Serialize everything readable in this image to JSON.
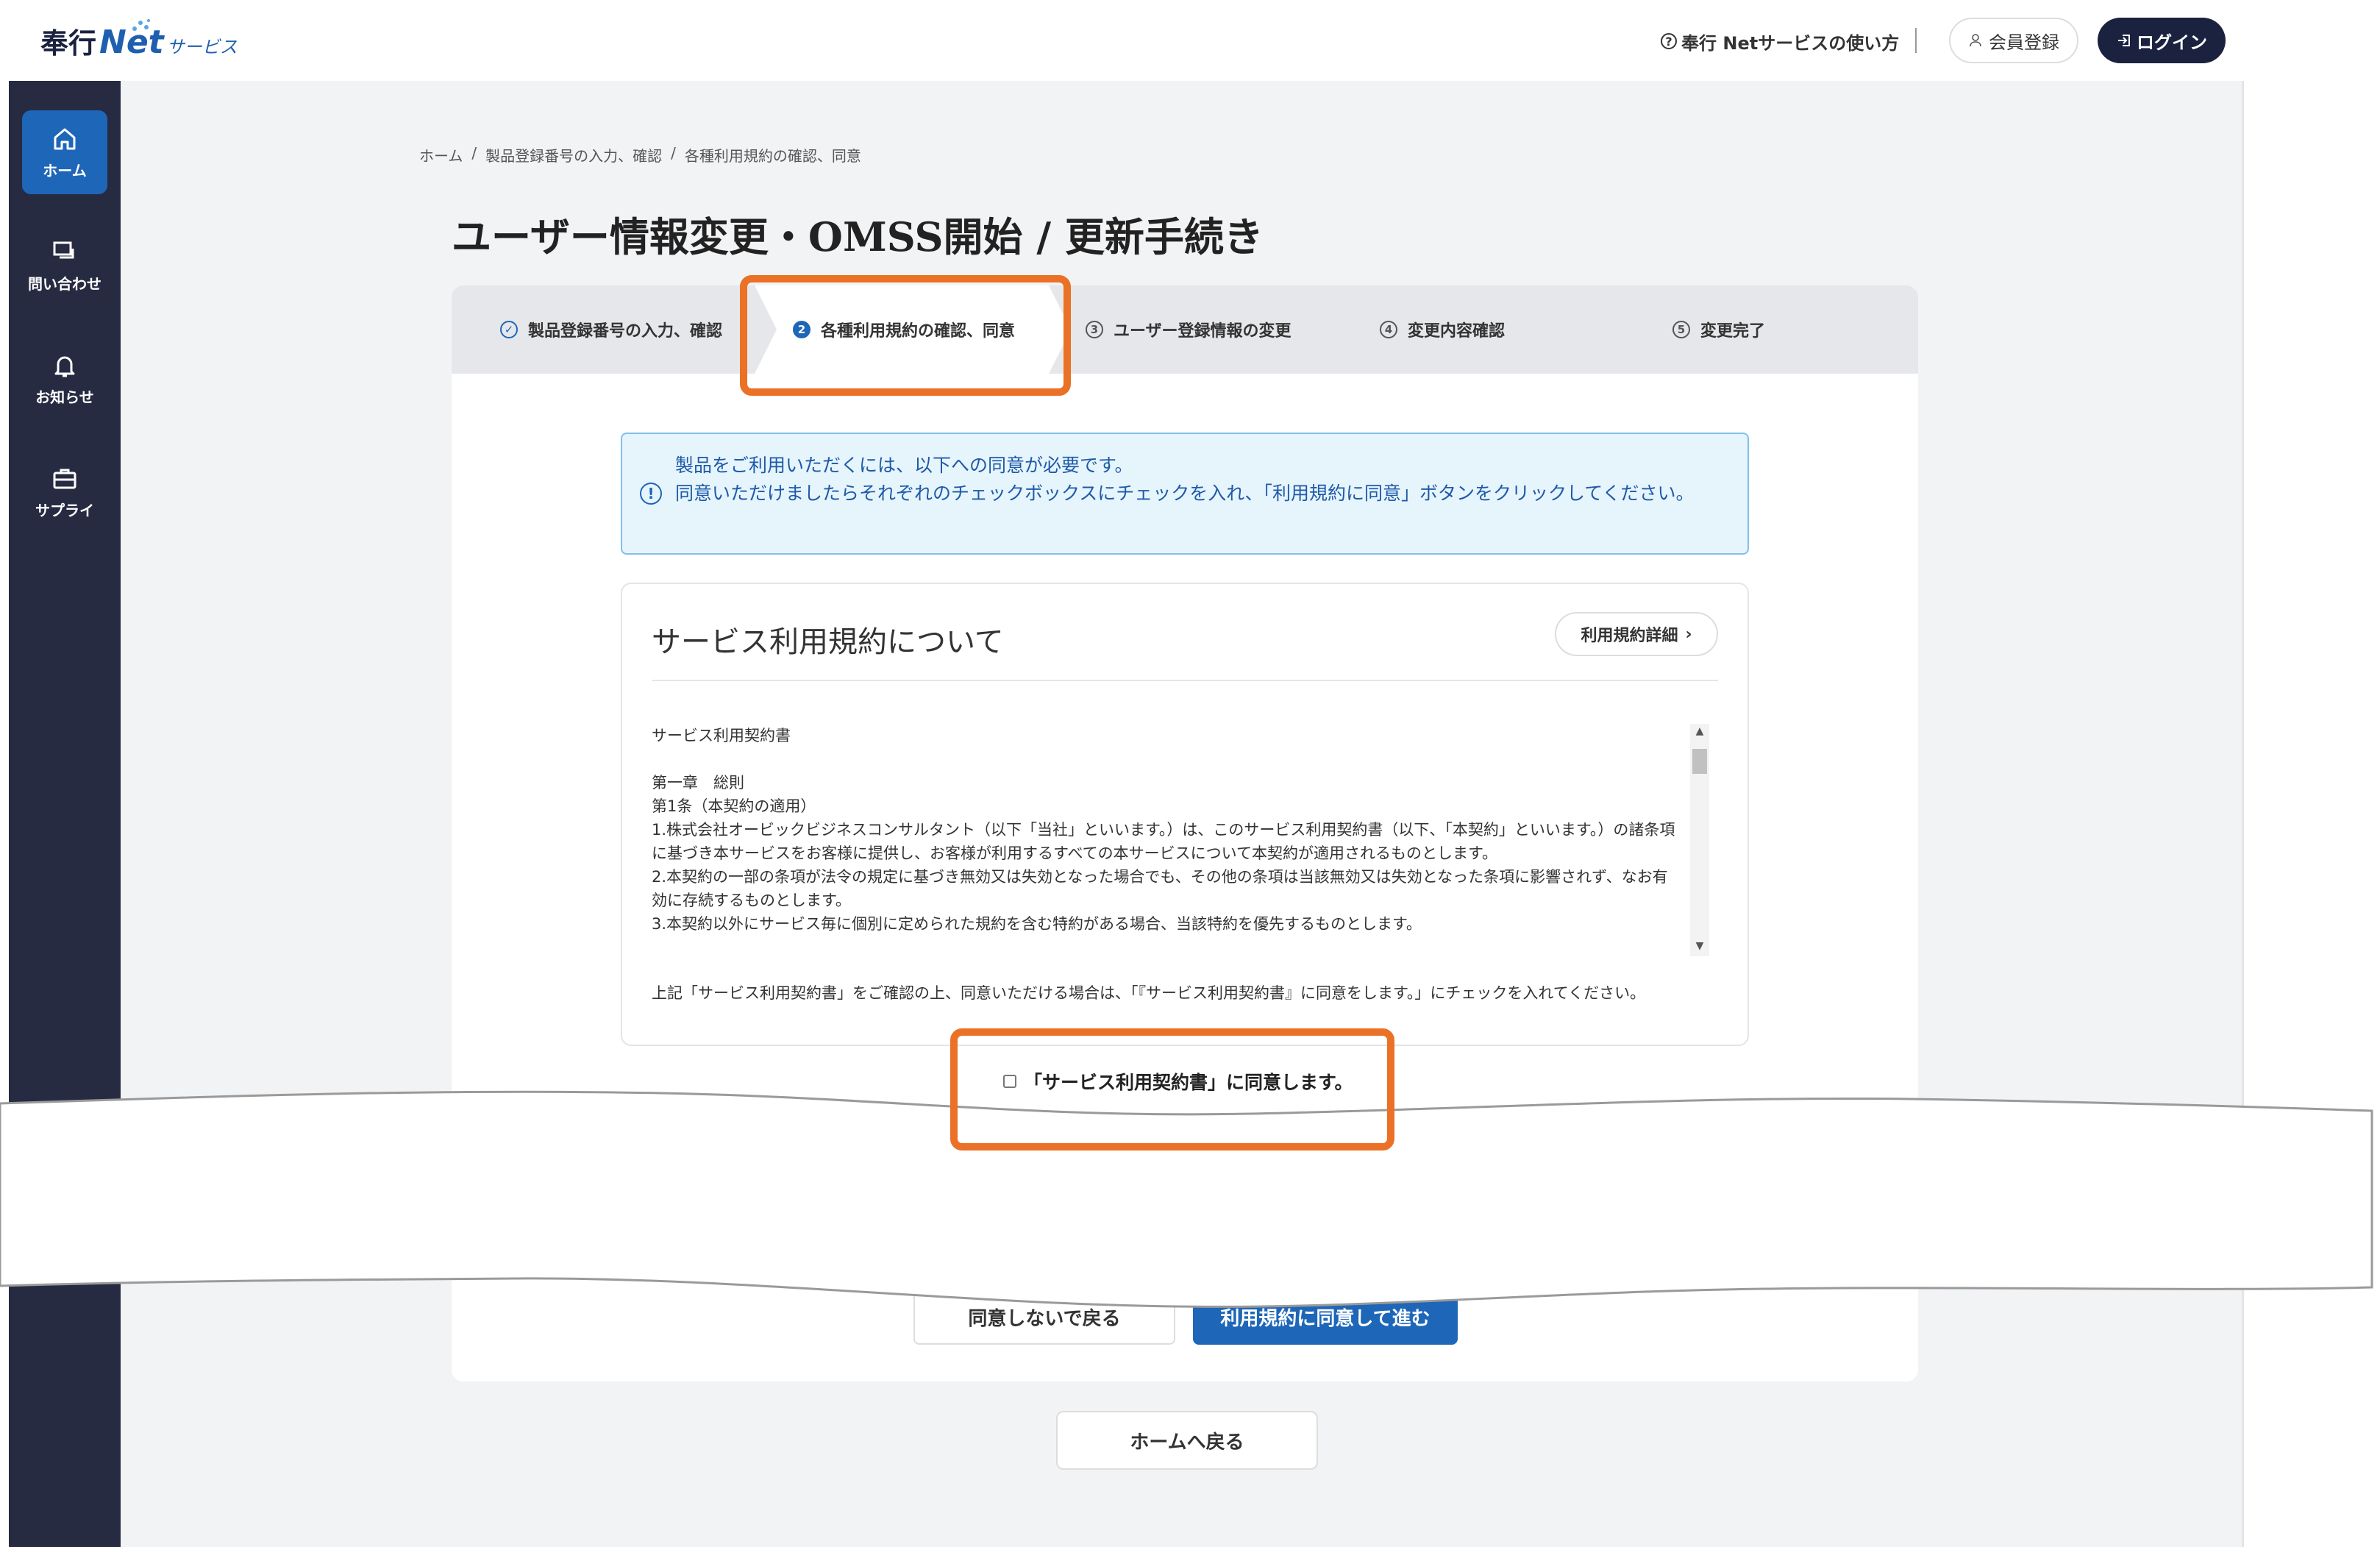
{
  "header": {
    "logo_main": "奉行",
    "logo_net": "Net",
    "logo_sub": "サービス",
    "help_link": "奉行 Netサービスの使い方",
    "register_button": "会員登録",
    "login_button": "ログイン"
  },
  "sidebar": {
    "items": [
      {
        "label": "ホーム"
      },
      {
        "label": "問い合わせ"
      },
      {
        "label": "お知らせ"
      },
      {
        "label": "サプライ"
      }
    ]
  },
  "breadcrumb": {
    "items": [
      "ホーム",
      "製品登録番号の入力、確認",
      "各種利用規約の確認、同意"
    ],
    "separator": "/"
  },
  "page_title": "ユーザー情報変更・OMSS開始 / 更新手続き",
  "steps": [
    {
      "num": "✓",
      "label": "製品登録番号の入力、確認"
    },
    {
      "num": "2",
      "label": "各種利用規約の確認、同意"
    },
    {
      "num": "3",
      "label": "ユーザー登録情報の変更"
    },
    {
      "num": "4",
      "label": "変更内容確認"
    },
    {
      "num": "5",
      "label": "変更完了"
    }
  ],
  "notice": {
    "icon": "!",
    "line1": "製品をご利用いただくには、以下への同意が必要です。",
    "line2": "同意いただけましたらそれぞれのチェックボックスにチェックを入れ、「利用規約に同意」ボタンをクリックしてください。"
  },
  "terms": {
    "title": "サービス利用規約について",
    "detail_button": "利用規約詳細",
    "body": [
      "サービス利用契約書",
      "",
      "第一章　総則",
      "第1条（本契約の適用）",
      "1.株式会社オービックビジネスコンサルタント（以下「当社」といいます。）は、このサービス利用契約書（以下、「本契約」といいます。）の諸条項に基づき本サービスをお客様に提供し、お客様が利用するすべての本サービスについて本契約が適用されるものとします。",
      "2.本契約の一部の条項が法令の規定に基づき無効又は失効となった場合でも、その他の条項は当該無効又は失効となった条項に影響されず、なお有効に存続するものとします。",
      "3.本契約以外にサービス毎に個別に定められた規約を含む特約がある場合、当該特約を優先するものとします。"
    ],
    "footer": "上記「サービス利用契約書」をご確認の上、同意いただける場合は、「『サービス利用契約書』に同意をします。」にチェックを入れてください。"
  },
  "agree_checkbox_label": "「サービス利用契約書」に同意します。",
  "buttons": {
    "back": "同意しないで戻る",
    "agree_next": "利用規約に同意して進む",
    "home": "ホームへ戻る"
  },
  "colors": {
    "primary": "#1e66b8",
    "sidebar": "#262b42",
    "highlight": "#ea7125",
    "notice_bg": "#e6f4fc"
  }
}
